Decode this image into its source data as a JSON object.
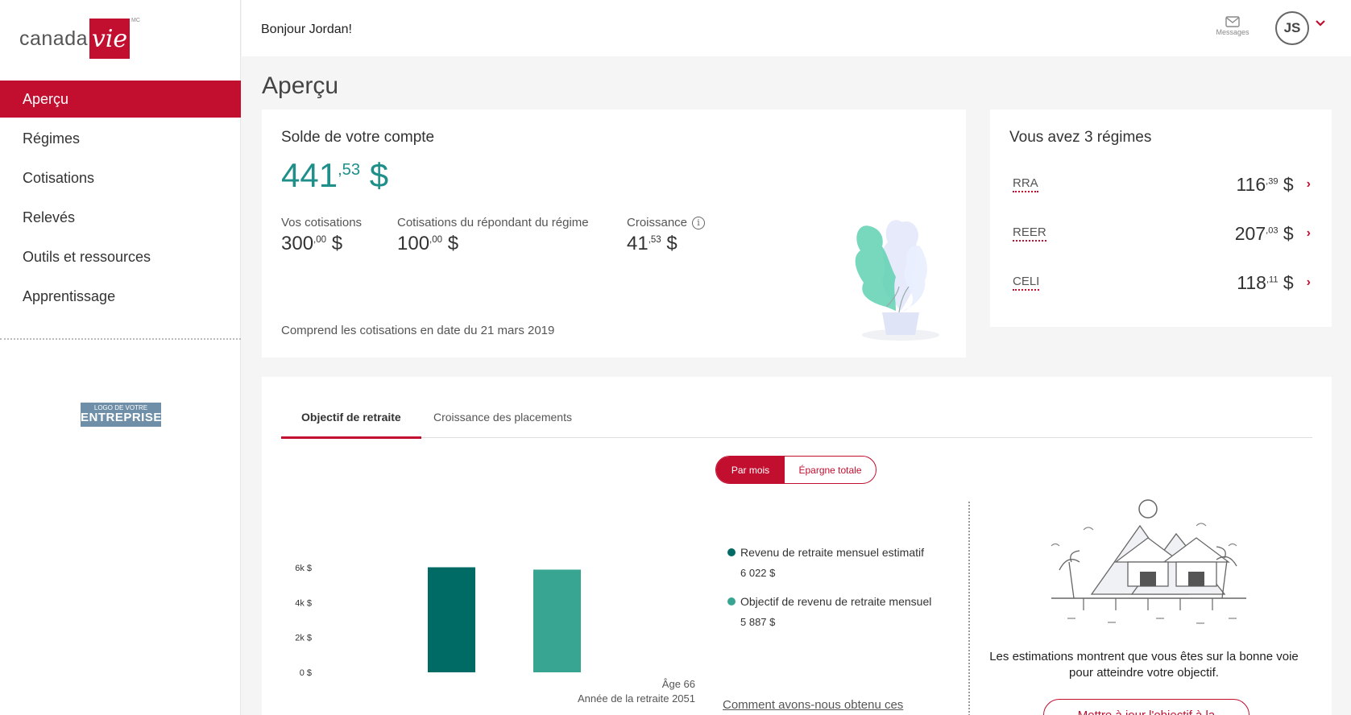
{
  "brand": {
    "logo_text": "canada",
    "logo_box": "vie",
    "logo_mark": "MC",
    "accent": "#c20f2f",
    "teal": "#1f8f8a"
  },
  "sidebar": {
    "items": [
      {
        "label": "Aperçu",
        "active": true
      },
      {
        "label": "Régimes"
      },
      {
        "label": "Cotisations"
      },
      {
        "label": "Relevés"
      },
      {
        "label": "Outils et ressources"
      },
      {
        "label": "Apprentissage"
      }
    ],
    "company_logo": {
      "line1": "LOGO DE VOTRE",
      "line2": "ENTREPRISE"
    }
  },
  "header": {
    "greeting": "Bonjour Jordan!",
    "messages_label": "Messages",
    "messages_icon": "envelope-icon",
    "avatar_initials": "JS"
  },
  "page_title": "Aperçu",
  "balance": {
    "title": "Solde de votre compte",
    "amount_int": "441",
    "amount_dec": ",53",
    "currency": "$",
    "metrics": [
      {
        "label": "Vos cotisations",
        "int": "300",
        "dec": ",00",
        "currency": "$"
      },
      {
        "label": "Cotisations du répondant du régime",
        "int": "100",
        "dec": ",00",
        "currency": "$"
      },
      {
        "label": "Croissance",
        "int": "41",
        "dec": ",53",
        "currency": "$",
        "info": "i"
      }
    ],
    "note": "Comprend les cotisations en date du 21 mars 2019"
  },
  "regimes": {
    "title": "Vous avez 3 régimes",
    "items": [
      {
        "name": "RRA",
        "int": "116",
        "dec": ",39",
        "currency": "$"
      },
      {
        "name": "REER",
        "int": "207",
        "dec": ",03",
        "currency": "$"
      },
      {
        "name": "CELI",
        "int": "118",
        "dec": ",11",
        "currency": "$"
      }
    ]
  },
  "goal": {
    "tabs": [
      "Objectif de retraite",
      "Croissance des placements"
    ],
    "toggle": [
      "Par mois",
      "Épargne totale"
    ],
    "age_label": "Âge 66",
    "year_label": "Année de la retraite 2051",
    "legend": [
      {
        "label": "Revenu de retraite mensuel estimatif",
        "value": "6 022 $",
        "color": "#006a65"
      },
      {
        "label": "Objectif de revenu de retraite mensuel",
        "value": "5 887 $",
        "color": "#38a592"
      }
    ],
    "how_link": "Comment avons-nous obtenu ces",
    "estimate_text": "Les estimations montrent que vous êtes sur la bonne voie pour atteindre votre objectif.",
    "update_button": "Mettre à jour l'objectif à la"
  },
  "chart_data": {
    "type": "bar",
    "categories": [
      "Revenu de retraite mensuel estimatif",
      "Objectif de revenu de retraite mensuel"
    ],
    "values": [
      6022,
      5887
    ],
    "colors": [
      "#006a65",
      "#38a592"
    ],
    "yticks": [
      0,
      2000,
      4000,
      6000
    ],
    "ytick_labels": [
      "0 $",
      "2k $",
      "4k $",
      "6k $"
    ],
    "ylim": [
      0,
      6000
    ]
  }
}
